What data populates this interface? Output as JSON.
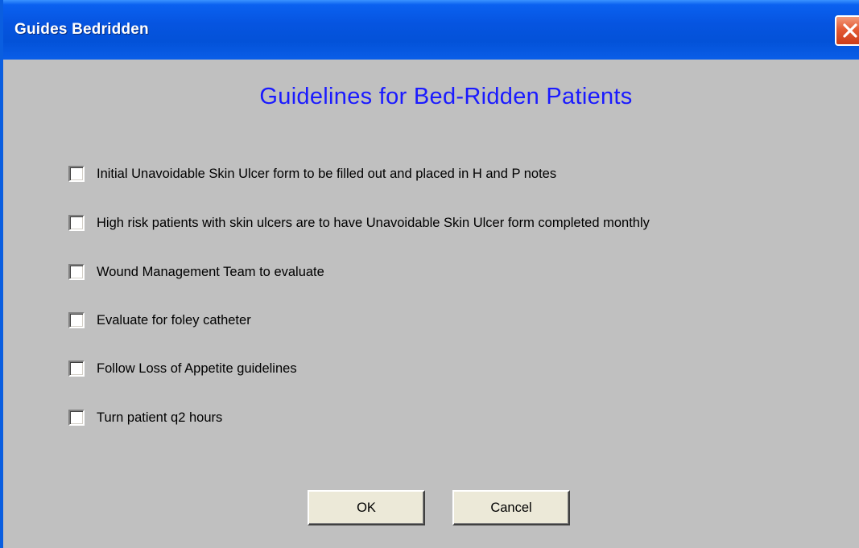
{
  "window": {
    "title": "Guides Bedridden"
  },
  "dialog": {
    "heading": "Guidelines for Bed-Ridden Patients",
    "options": [
      {
        "label": "Initial Unavoidable Skin Ulcer form to be filled out and placed in H and P notes",
        "checked": false
      },
      {
        "label": "High risk patients with skin ulcers are to have Unavoidable Skin Ulcer form completed monthly",
        "checked": false
      },
      {
        "label": "Wound Management Team to evaluate",
        "checked": false
      },
      {
        "label": "Evaluate for foley catheter",
        "checked": false
      },
      {
        "label": "Follow Loss of Appetite guidelines",
        "checked": false
      },
      {
        "label": "Turn patient q2 hours",
        "checked": false
      }
    ],
    "ok_label": "OK",
    "cancel_label": "Cancel"
  },
  "colors": {
    "titlebar": "#0654e0",
    "heading": "#1a1aff",
    "panel": "#c0c0c0",
    "close_button": "#e35b34"
  },
  "icons": {
    "close": "close-icon"
  }
}
